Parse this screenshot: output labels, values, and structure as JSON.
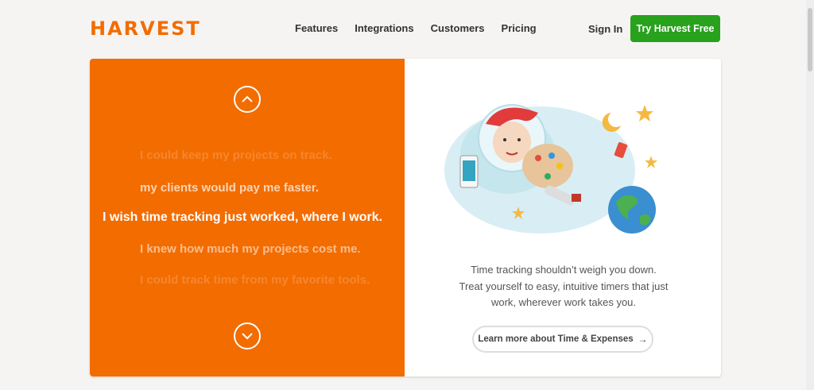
{
  "header": {
    "logo": "HARVEST",
    "nav": [
      "Features",
      "Integrations",
      "Customers",
      "Pricing"
    ],
    "signin": "Sign In",
    "cta": "Try Harvest Free"
  },
  "hero": {
    "wishes": [
      "I could keep my projects on track.",
      "my clients would pay me faster.",
      "I wish time tracking just worked, where I work.",
      "I knew how much my projects cost me.",
      "I could track time from my favorite tools."
    ],
    "description": [
      "Time tracking shouldn’t weigh you down.",
      "Treat yourself to easy, intuitive timers that just",
      "work, wherever work takes you."
    ],
    "learn_more": "Learn more about Time & Expenses",
    "learn_more_arrow": "→"
  },
  "colors": {
    "brand_orange": "#f36c00",
    "cta_green": "#28a11d"
  }
}
